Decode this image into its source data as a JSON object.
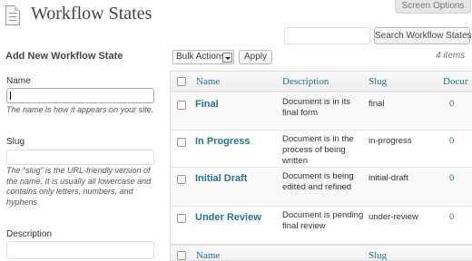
{
  "header": {
    "title": "Workflow States",
    "screen_options": "Screen Options"
  },
  "search": {
    "value": "",
    "button": "Search Workflow States"
  },
  "form": {
    "heading": "Add New Workflow State",
    "name_label": "Name",
    "name_help": "The name is how it appears on your site.",
    "slug_label": "Slug",
    "slug_help": "The “slug” is the URL-friendly version of the name. It is usually all lowercase and contains only letters, numbers, and hyphens.",
    "description_label": "Description"
  },
  "bulk": {
    "selected": "Bulk Actions",
    "apply": "Apply"
  },
  "item_count": "4 items",
  "table": {
    "columns": [
      "Name",
      "Description",
      "Slug",
      "Docur"
    ],
    "footer_columns": [
      "Name",
      "",
      "Slug",
      ""
    ],
    "rows": [
      {
        "name": "Final",
        "description": "Document is in its final form",
        "slug": "final",
        "count": "0"
      },
      {
        "name": "In Progress",
        "description": "Document is in the process of being written",
        "slug": "in-progress",
        "count": "0"
      },
      {
        "name": "Initial Draft",
        "description": "Document is being edited and refined",
        "slug": "initial-draft",
        "count": "0"
      },
      {
        "name": "Under Review",
        "description": "Document is pending final review",
        "slug": "under-review",
        "count": "0"
      }
    ]
  }
}
